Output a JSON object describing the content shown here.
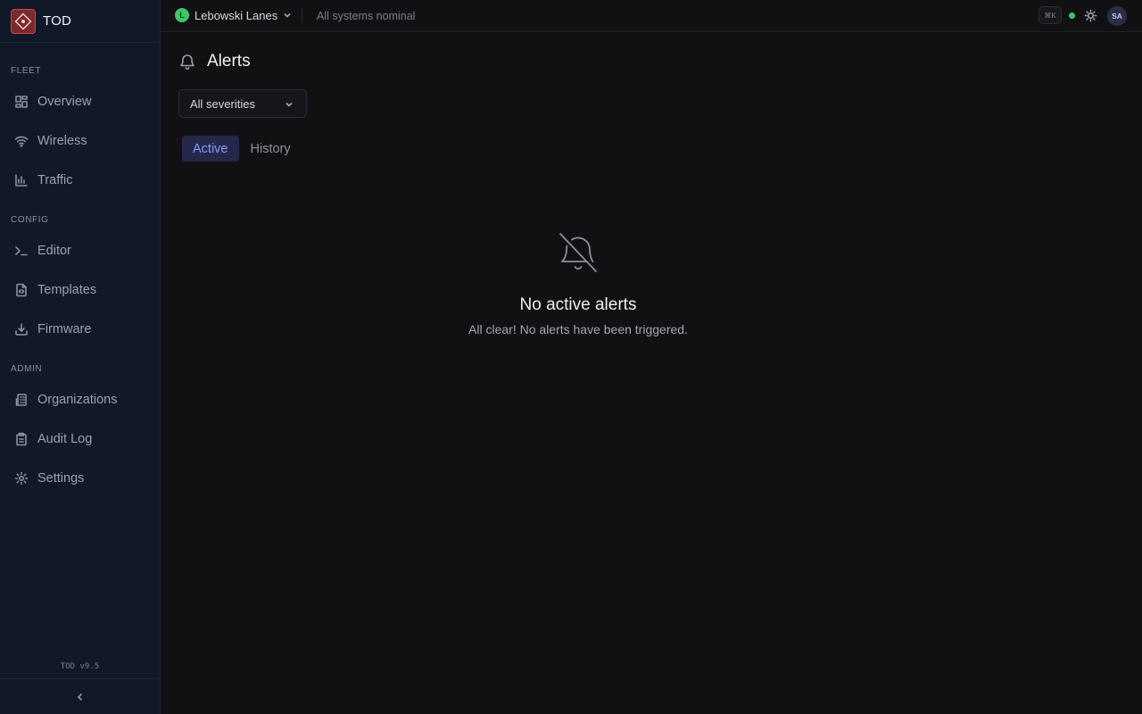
{
  "brand": {
    "name": "TOD",
    "logo_icon": "tod-logo-icon",
    "accent": "#c24a4a"
  },
  "sidebar": {
    "sections": [
      {
        "label": "FLEET",
        "items": [
          {
            "label": "Overview",
            "icon": "grid-icon"
          },
          {
            "label": "Wireless",
            "icon": "wifi-icon"
          },
          {
            "label": "Traffic",
            "icon": "bar-chart-icon"
          }
        ]
      },
      {
        "label": "CONFIG",
        "items": [
          {
            "label": "Editor",
            "icon": "terminal-icon"
          },
          {
            "label": "Templates",
            "icon": "file-code-icon"
          },
          {
            "label": "Firmware",
            "icon": "download-icon"
          }
        ]
      },
      {
        "label": "ADMIN",
        "items": [
          {
            "label": "Organizations",
            "icon": "building-icon"
          },
          {
            "label": "Audit Log",
            "icon": "clipboard-icon"
          },
          {
            "label": "Settings",
            "icon": "gear-icon"
          }
        ]
      }
    ],
    "version": "TOD v9.5",
    "collapse_icon": "chevron-left-icon"
  },
  "topbar": {
    "org_initial": "L",
    "org_name": "Lebowski Lanes",
    "status": "All systems nominal",
    "shortcut": "⌘K",
    "status_color": "#3cc76a",
    "avatar_initials": "SA"
  },
  "main": {
    "title": "Alerts",
    "severity_filter": {
      "value": "All severities"
    },
    "tabs": [
      {
        "label": "Active",
        "active": true
      },
      {
        "label": "History",
        "active": false
      }
    ],
    "empty_state": {
      "icon": "bell-off-icon",
      "title": "No active alerts",
      "message": "All clear! No alerts have been triggered."
    }
  }
}
